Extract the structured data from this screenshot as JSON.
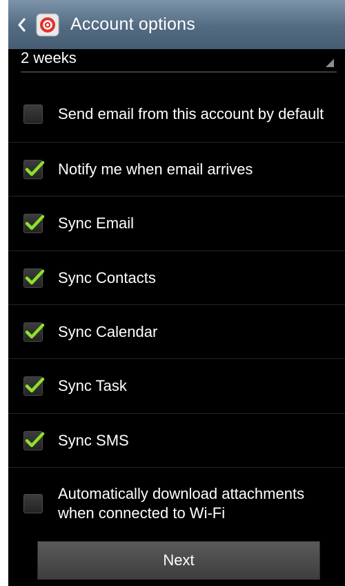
{
  "header": {
    "title": "Account options",
    "back_icon": "chevron-left-icon",
    "app_icon": "email-app-icon"
  },
  "sync_period": {
    "value": "2 weeks"
  },
  "options": [
    {
      "label": "Send email from this account by default",
      "checked": false
    },
    {
      "label": "Notify me when email arrives",
      "checked": true
    },
    {
      "label": "Sync Email",
      "checked": true
    },
    {
      "label": "Sync Contacts",
      "checked": true
    },
    {
      "label": "Sync Calendar",
      "checked": true
    },
    {
      "label": "Sync Task",
      "checked": true
    },
    {
      "label": "Sync SMS",
      "checked": true
    },
    {
      "label": "Automatically download attachments when connected to Wi-Fi",
      "checked": false
    }
  ],
  "footer": {
    "next_label": "Next"
  },
  "colors": {
    "app_bar": "#536b82",
    "checkmark": "#8fe02a",
    "background": "#000000"
  }
}
